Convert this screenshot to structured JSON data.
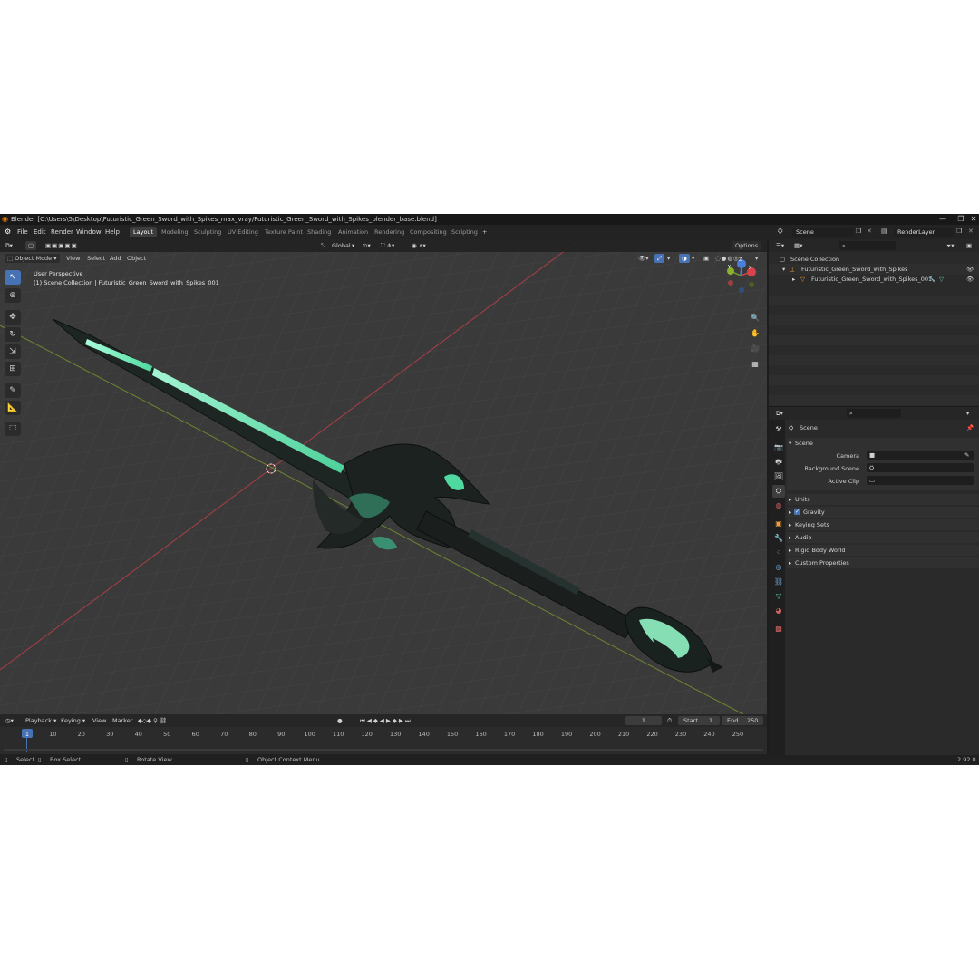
{
  "window": {
    "title": "Blender [C:\\Users\\5\\Desktop\\Futuristic_Green_Sword_with_Spikes_max_vray/Futuristic_Green_Sword_with_Spikes_blender_base.blend]",
    "minimize": "—",
    "maximize": "❐",
    "close": "✕"
  },
  "menu": [
    "File",
    "Edit",
    "Render",
    "Window",
    "Help"
  ],
  "workspaces": [
    "Layout",
    "Modeling",
    "Sculpting",
    "UV Editing",
    "Texture Paint",
    "Shading",
    "Animation",
    "Rendering",
    "Compositing",
    "Scripting"
  ],
  "workspace_add": "+",
  "topbar": {
    "scene_label": "Scene",
    "layer_label": "RenderLayer"
  },
  "viewport": {
    "mode": "Object Mode",
    "menus": [
      "View",
      "Select",
      "Add",
      "Object"
    ],
    "transform": "Global",
    "options": "Options",
    "overlay_title": "User Perspective",
    "overlay_subtitle": "(1) Scene Collection | Futuristic_Green_Sword_with_Spikes_001",
    "gizmo": {
      "x": "X",
      "y": "Y",
      "z": "Z"
    }
  },
  "timeline": {
    "menus": [
      "Playback",
      "Keying",
      "View",
      "Marker"
    ],
    "current_frame": "1",
    "start_label": "Start",
    "start_value": "1",
    "end_label": "End",
    "end_value": "250",
    "frames": [
      "1",
      "10",
      "20",
      "30",
      "40",
      "50",
      "60",
      "70",
      "80",
      "90",
      "100",
      "110",
      "120",
      "130",
      "140",
      "150",
      "160",
      "170",
      "180",
      "190",
      "200",
      "210",
      "220",
      "230",
      "240",
      "250"
    ]
  },
  "statusbar": {
    "select": "Select",
    "box_select": "Box Select",
    "rotate": "Rotate View",
    "context": "Object Context Menu",
    "version": "2.92.0"
  },
  "outliner": {
    "root": "Scene Collection",
    "items": [
      {
        "label": "Futuristic_Green_Sword_with_Spikes"
      },
      {
        "label": "Futuristic_Green_Sword_with_Spikes_001"
      }
    ]
  },
  "properties": {
    "context": "Scene",
    "section": "Scene",
    "fields": [
      {
        "label": "Camera"
      },
      {
        "label": "Background Scene"
      },
      {
        "label": "Active Clip"
      }
    ],
    "panels": [
      "Units",
      "Gravity",
      "Keying Sets",
      "Audio",
      "Rigid Body World",
      "Custom Properties"
    ]
  },
  "colors": {
    "accent": "#4772b3",
    "viewport_bg": "#393939",
    "sword_glow": "#7dffc8",
    "axis_x": "#c8404a",
    "axis_y": "#7a9a2a"
  }
}
